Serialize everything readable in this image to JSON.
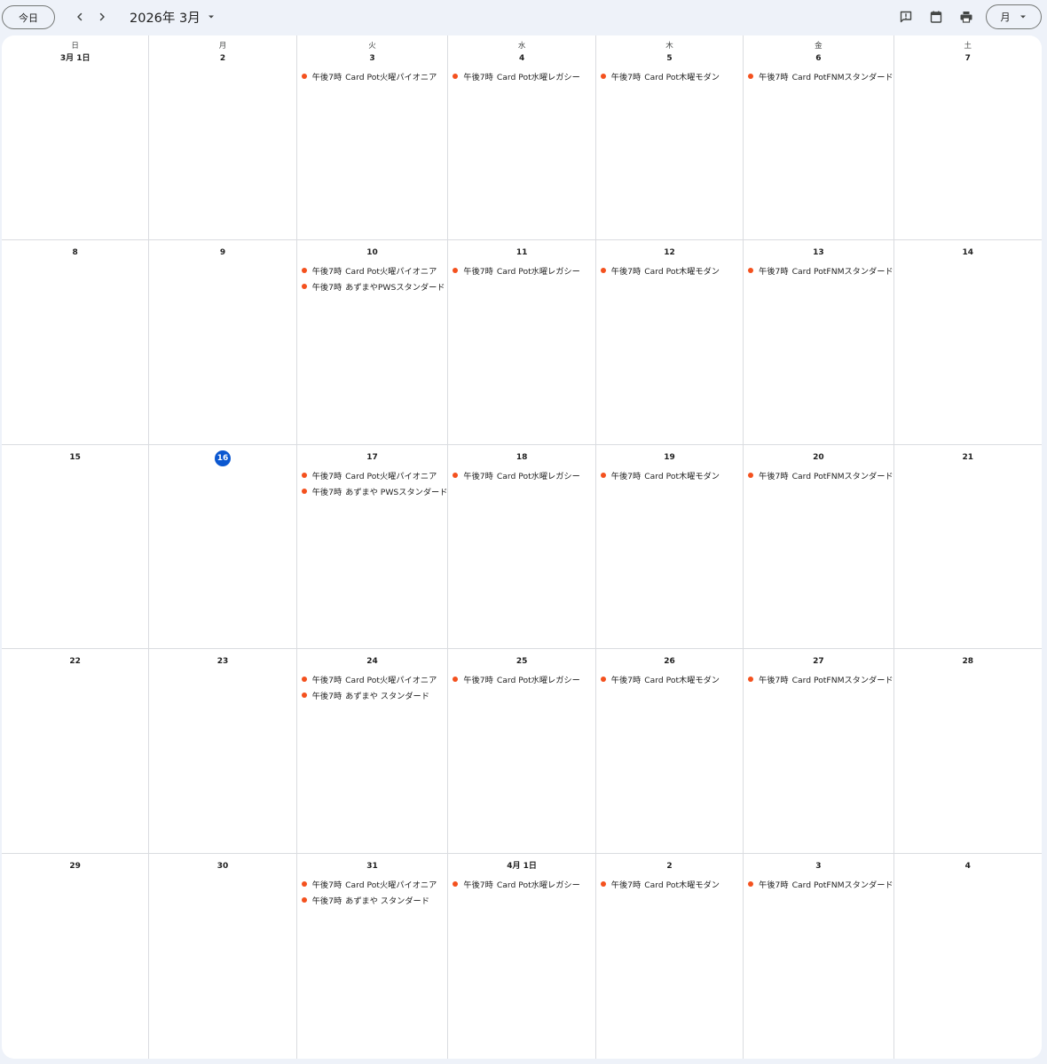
{
  "toolbar": {
    "today_label": "今日",
    "month_label": "2026年 3月",
    "view_label": "月"
  },
  "icons": {
    "prev": "chevron-left-icon",
    "next": "chevron-right-icon",
    "dropdown": "caret-down-icon",
    "feedback": "feedback-icon",
    "calendar": "calendar-icon",
    "print": "print-icon"
  },
  "colors": {
    "event_dot": "#f4511e",
    "today_circle": "#0b57d0"
  },
  "weekdays": [
    "日",
    "月",
    "火",
    "水",
    "木",
    "金",
    "土"
  ],
  "weeks": [
    [
      {
        "date": "3月 1日",
        "events": []
      },
      {
        "date": "2",
        "events": []
      },
      {
        "date": "3",
        "events": [
          {
            "time": "午後7時",
            "title": "Card Pot火曜パイオニア"
          }
        ]
      },
      {
        "date": "4",
        "events": [
          {
            "time": "午後7時",
            "title": "Card Pot水曜レガシー"
          }
        ]
      },
      {
        "date": "5",
        "events": [
          {
            "time": "午後7時",
            "title": "Card Pot木曜モダン"
          }
        ]
      },
      {
        "date": "6",
        "events": [
          {
            "time": "午後7時",
            "title": "Card PotFNMスタンダード"
          }
        ]
      },
      {
        "date": "7",
        "events": []
      }
    ],
    [
      {
        "date": "8",
        "events": []
      },
      {
        "date": "9",
        "events": []
      },
      {
        "date": "10",
        "events": [
          {
            "time": "午後7時",
            "title": "Card Pot火曜パイオニア"
          },
          {
            "time": "午後7時",
            "title": "あずまやPWSスタンダード"
          }
        ]
      },
      {
        "date": "11",
        "events": [
          {
            "time": "午後7時",
            "title": "Card Pot水曜レガシー"
          }
        ]
      },
      {
        "date": "12",
        "events": [
          {
            "time": "午後7時",
            "title": "Card Pot木曜モダン"
          }
        ]
      },
      {
        "date": "13",
        "events": [
          {
            "time": "午後7時",
            "title": "Card PotFNMスタンダード"
          }
        ]
      },
      {
        "date": "14",
        "events": []
      }
    ],
    [
      {
        "date": "15",
        "events": []
      },
      {
        "date": "16",
        "today": true,
        "events": []
      },
      {
        "date": "17",
        "events": [
          {
            "time": "午後7時",
            "title": "Card Pot火曜パイオニア"
          },
          {
            "time": "午後7時",
            "title": "あずまや PWSスタンダード"
          }
        ]
      },
      {
        "date": "18",
        "events": [
          {
            "time": "午後7時",
            "title": "Card Pot水曜レガシー"
          }
        ]
      },
      {
        "date": "19",
        "events": [
          {
            "time": "午後7時",
            "title": "Card Pot木曜モダン"
          }
        ]
      },
      {
        "date": "20",
        "events": [
          {
            "time": "午後7時",
            "title": "Card PotFNMスタンダード"
          }
        ]
      },
      {
        "date": "21",
        "events": []
      }
    ],
    [
      {
        "date": "22",
        "events": []
      },
      {
        "date": "23",
        "events": []
      },
      {
        "date": "24",
        "events": [
          {
            "time": "午後7時",
            "title": "Card Pot火曜パイオニア"
          },
          {
            "time": "午後7時",
            "title": "あずまや スタンダード"
          }
        ]
      },
      {
        "date": "25",
        "events": [
          {
            "time": "午後7時",
            "title": "Card Pot水曜レガシー"
          }
        ]
      },
      {
        "date": "26",
        "events": [
          {
            "time": "午後7時",
            "title": "Card Pot木曜モダン"
          }
        ]
      },
      {
        "date": "27",
        "events": [
          {
            "time": "午後7時",
            "title": "Card PotFNMスタンダード"
          }
        ]
      },
      {
        "date": "28",
        "events": []
      }
    ],
    [
      {
        "date": "29",
        "events": []
      },
      {
        "date": "30",
        "events": []
      },
      {
        "date": "31",
        "events": [
          {
            "time": "午後7時",
            "title": "Card Pot火曜パイオニア"
          },
          {
            "time": "午後7時",
            "title": "あずまや スタンダード"
          }
        ]
      },
      {
        "date": "4月 1日",
        "events": [
          {
            "time": "午後7時",
            "title": "Card Pot水曜レガシー"
          }
        ]
      },
      {
        "date": "2",
        "events": [
          {
            "time": "午後7時",
            "title": "Card Pot木曜モダン"
          }
        ]
      },
      {
        "date": "3",
        "events": [
          {
            "time": "午後7時",
            "title": "Card PotFNMスタンダード"
          }
        ]
      },
      {
        "date": "4",
        "events": []
      }
    ]
  ]
}
